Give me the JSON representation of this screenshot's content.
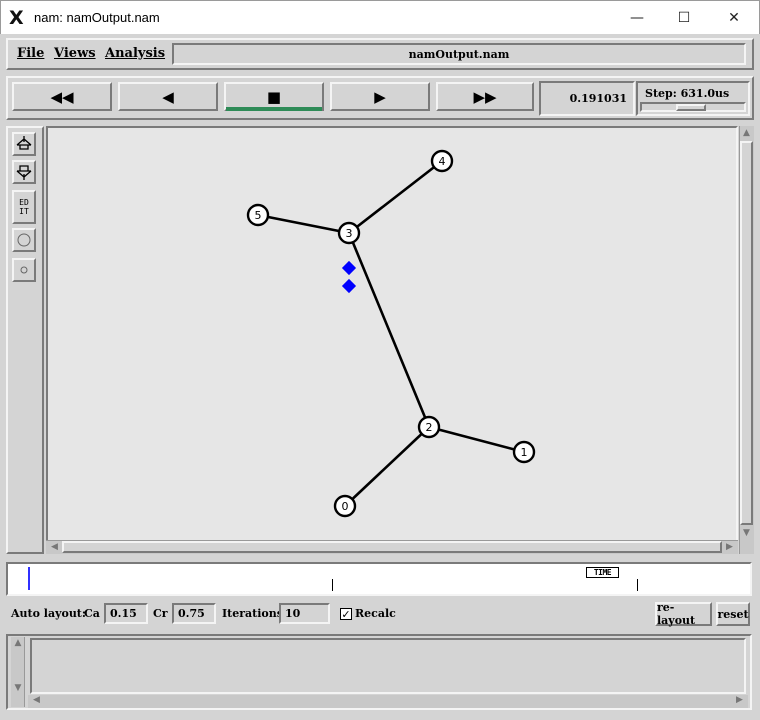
{
  "window": {
    "title": "nam: namOutput.nam",
    "minimize_glyph": "—",
    "maximize_glyph": "☐",
    "close_glyph": "✕"
  },
  "menu": {
    "file": "File",
    "views": "Views",
    "analysis": "Analysis",
    "filename": "namOutput.nam"
  },
  "transport": {
    "rewind": "◀◀",
    "back": "◀",
    "stop": "■",
    "play": "▶",
    "fast_forward": "▶▶",
    "time": "0.191031",
    "step_label": "Step: 631.0us"
  },
  "tools": {
    "edit_label": "ED\nIT"
  },
  "graph": {
    "nodes": [
      "0",
      "1",
      "2",
      "3",
      "4",
      "5"
    ]
  },
  "timeline": {
    "time_marker_label": "TIME"
  },
  "layout": {
    "auto_layout_label": "Auto layout:",
    "ca_label": "Ca",
    "ca_value": "0.15",
    "cr_label": "Cr",
    "cr_value": "0.75",
    "iterations_label": "Iterations",
    "iterations_value": "10",
    "recalc_label": "Recalc",
    "recalc_checked": true,
    "relayout_label": "re-layout",
    "reset_label": "reset"
  },
  "colors": {
    "packet": "#0000ff",
    "canvas_bg": "#e6e6e6",
    "stop_indicator": "#2e8b57"
  }
}
